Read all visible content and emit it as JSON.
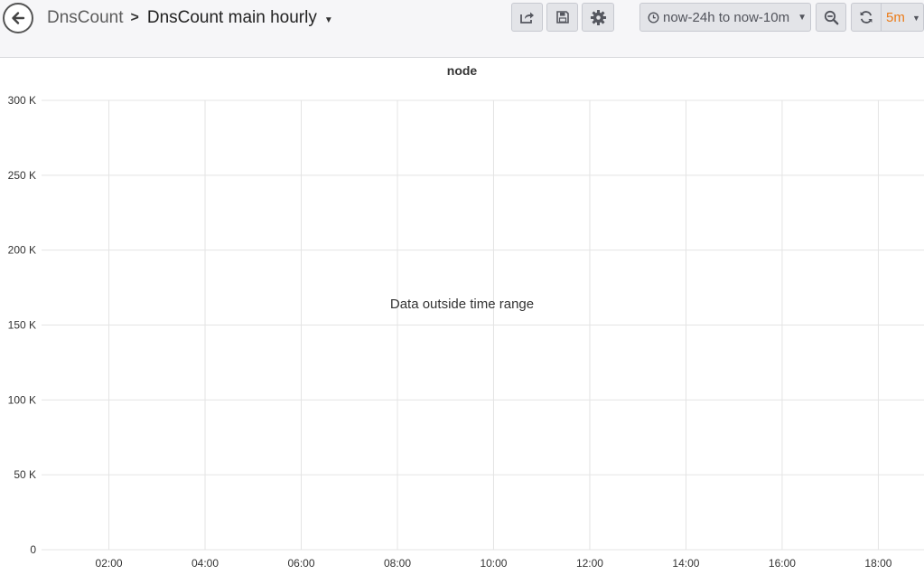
{
  "navbar": {
    "breadcrumb_folder": "DnsCount",
    "breadcrumb_separator": ">",
    "dashboard_title": "DnsCount main hourly",
    "time_range": "now-24h to now-10m",
    "refresh_interval": "5m",
    "icons": {
      "back": "arrow-left-icon",
      "share": "share-icon",
      "save": "save-icon",
      "settings": "gear-icon",
      "time": "clock-icon",
      "zoom": "zoom-out-icon",
      "refresh": "refresh-icon"
    }
  },
  "panel": {
    "title": "node",
    "message": "Data outside time range"
  },
  "chart_data": {
    "type": "line",
    "title": "node",
    "xlabel": "",
    "ylabel": "",
    "y_ticks": [
      "0",
      "50 K",
      "100 K",
      "150 K",
      "200 K",
      "250 K",
      "300 K"
    ],
    "y_tick_values": [
      0,
      50000,
      100000,
      150000,
      200000,
      250000,
      300000
    ],
    "ylim": [
      0,
      300000
    ],
    "x_ticks": [
      "02:00",
      "04:00",
      "06:00",
      "08:00",
      "10:00",
      "12:00",
      "14:00",
      "16:00",
      "18:00"
    ],
    "x_tick_hours": [
      2,
      4,
      6,
      8,
      10,
      12,
      14,
      16,
      18
    ],
    "xlim_hours": [
      0.6,
      18.95
    ],
    "grid": true,
    "series": []
  }
}
